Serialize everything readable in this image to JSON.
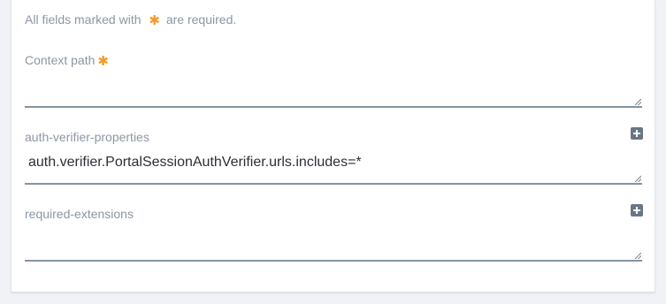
{
  "form": {
    "required_note_prefix": "All fields marked with",
    "required_note_suffix": "are required.",
    "required_marker": "✱",
    "colors": {
      "required_marker": "#f59a23",
      "label": "#8c96a4",
      "field_underline": "#8592a3",
      "add_icon": "#6b7685",
      "panel_background": "#ffffff",
      "page_background": "#f1f2f5"
    },
    "fields": {
      "context_path": {
        "label": "Context path",
        "value": "",
        "required": true
      },
      "auth_verifier_properties": {
        "label": "auth-verifier-properties",
        "value": "auth.verifier.PortalSessionAuthVerifier.urls.includes=*",
        "add_icon": "plus-square-icon"
      },
      "required_extensions": {
        "label": "required-extensions",
        "value": "",
        "add_icon": "plus-square-icon"
      }
    }
  }
}
